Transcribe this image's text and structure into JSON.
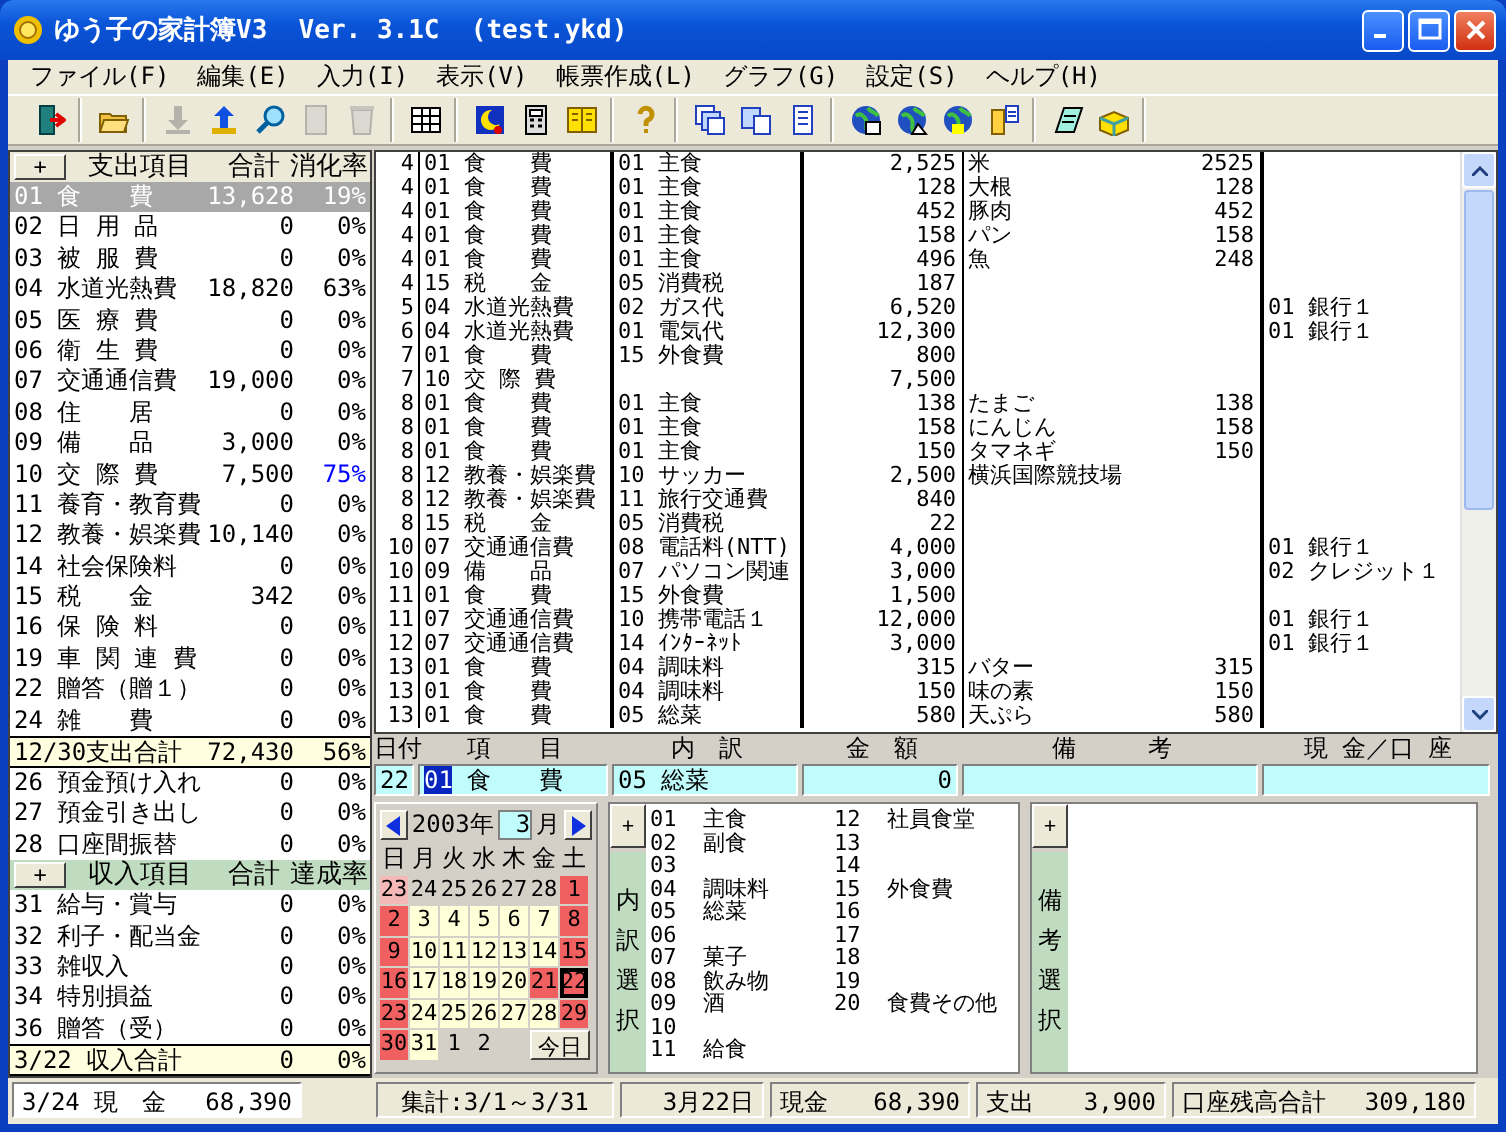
{
  "window": {
    "title": "ゆう子の家計簿V3  Ver. 3.1C  (test.ykd)"
  },
  "menu": [
    "ファイル(F)",
    "編集(E)",
    "入力(I)",
    "表示(V)",
    "帳票作成(L)",
    "グラフ(G)",
    "設定(S)",
    "ヘルプ(H)"
  ],
  "toolbar": [
    [
      {
        "disabled": false
      }
    ],
    [
      {
        "disabled": false
      }
    ],
    [
      {
        "disabled": true
      },
      {
        "disabled": false
      },
      {
        "disabled": false
      },
      {
        "disabled": true
      },
      {
        "disabled": true
      }
    ],
    [
      {
        "disabled": false
      }
    ],
    [
      {
        "disabled": false
      },
      {
        "disabled": false
      },
      {
        "disabled": false
      }
    ],
    [
      {
        "disabled": false
      }
    ],
    [
      {
        "disabled": false
      },
      {
        "disabled": false
      },
      {
        "disabled": false
      }
    ],
    [
      {
        "disabled": false
      },
      {
        "disabled": false
      },
      {
        "disabled": false
      },
      {
        "disabled": false
      }
    ],
    [
      {
        "disabled": false
      },
      {
        "disabled": false
      }
    ]
  ],
  "expense": {
    "button": "+",
    "columns": [
      "支出項目",
      "合計",
      "消化率"
    ],
    "items": [
      {
        "code": "01",
        "name": "食　　費",
        "total": "13,628",
        "rate": "19%",
        "selected": true,
        "alert": false
      },
      {
        "code": "02",
        "name": "日 用 品",
        "total": "0",
        "rate": "0%",
        "selected": false,
        "alert": false
      },
      {
        "code": "03",
        "name": "被 服 費",
        "total": "0",
        "rate": "0%",
        "selected": false,
        "alert": false
      },
      {
        "code": "04",
        "name": "水道光熱費",
        "total": "18,820",
        "rate": "63%",
        "selected": false,
        "alert": false
      },
      {
        "code": "05",
        "name": "医 療 費",
        "total": "0",
        "rate": "0%",
        "selected": false,
        "alert": false
      },
      {
        "code": "06",
        "name": "衛 生 費",
        "total": "0",
        "rate": "0%",
        "selected": false,
        "alert": false
      },
      {
        "code": "07",
        "name": "交通通信費",
        "total": "19,000",
        "rate": "0%",
        "selected": false,
        "alert": false
      },
      {
        "code": "08",
        "name": "住　　居",
        "total": "0",
        "rate": "0%",
        "selected": false,
        "alert": false
      },
      {
        "code": "09",
        "name": "備　　品",
        "total": "3,000",
        "rate": "0%",
        "selected": false,
        "alert": false
      },
      {
        "code": "10",
        "name": "交 際 費",
        "total": "7,500",
        "rate": "75%",
        "selected": false,
        "alert": true
      },
      {
        "code": "11",
        "name": "養育・教育費",
        "total": "0",
        "rate": "0%",
        "selected": false,
        "alert": false
      },
      {
        "code": "12",
        "name": "教養・娯楽費",
        "total": "10,140",
        "rate": "0%",
        "selected": false,
        "alert": false
      },
      {
        "code": "14",
        "name": "社会保険料",
        "total": "0",
        "rate": "0%",
        "selected": false,
        "alert": false
      },
      {
        "code": "15",
        "name": "税　　金",
        "total": "342",
        "rate": "0%",
        "selected": false,
        "alert": false
      },
      {
        "code": "16",
        "name": "保 険 料",
        "total": "0",
        "rate": "0%",
        "selected": false,
        "alert": false
      },
      {
        "code": "19",
        "name": "車 関 連 費",
        "total": "0",
        "rate": "0%",
        "selected": false,
        "alert": false
      },
      {
        "code": "22",
        "name": "贈答（贈１）",
        "total": "0",
        "rate": "0%",
        "selected": false,
        "alert": false
      },
      {
        "code": "24",
        "name": "雑　　費",
        "total": "0",
        "rate": "0%",
        "selected": false,
        "alert": false
      }
    ],
    "total": {
      "label": "12/30支出合計",
      "total": "72,430",
      "rate": "56%"
    }
  },
  "transfers": [
    {
      "code": "26",
      "name": "預金預け入れ",
      "total": "0",
      "rate": "0%"
    },
    {
      "code": "27",
      "name": "預金引き出し",
      "total": "0",
      "rate": "0%"
    },
    {
      "code": "28",
      "name": "口座間振替",
      "total": "0",
      "rate": "0%"
    }
  ],
  "income": {
    "button": "+",
    "columns": [
      "収入項目",
      "合計",
      "達成率"
    ],
    "items": [
      {
        "code": "31",
        "name": "給与・賞与",
        "total": "0",
        "rate": "0%",
        "selected": false,
        "alert": false
      },
      {
        "code": "32",
        "name": "利子・配当金",
        "total": "0",
        "rate": "0%",
        "selected": false,
        "alert": false
      },
      {
        "code": "33",
        "name": "雑収入",
        "total": "0",
        "rate": "0%",
        "selected": false,
        "alert": false
      },
      {
        "code": "34",
        "name": "特別損益",
        "total": "0",
        "rate": "0%",
        "selected": false,
        "alert": false
      },
      {
        "code": "36",
        "name": "贈答（受）",
        "total": "0",
        "rate": "0%",
        "selected": false,
        "alert": false
      }
    ],
    "total": {
      "label": "3/22 収入合計",
      "total": "0",
      "rate": "0%"
    }
  },
  "cash": {
    "label": "3/24 現　金",
    "value": "68,390"
  },
  "entries": [
    {
      "day": "4",
      "category_code": "01",
      "category": "食　　費",
      "sub_code": "01",
      "sub": "主食",
      "amount": "2,525",
      "memo": "米",
      "memo_amount": "2525"
    },
    {
      "day": "4",
      "category_code": "01",
      "category": "食　　費",
      "sub_code": "01",
      "sub": "主食",
      "amount": "128",
      "memo": "大根",
      "memo_amount": "128"
    },
    {
      "day": "4",
      "category_code": "01",
      "category": "食　　費",
      "sub_code": "01",
      "sub": "主食",
      "amount": "452",
      "memo": "豚肉",
      "memo_amount": "452"
    },
    {
      "day": "4",
      "category_code": "01",
      "category": "食　　費",
      "sub_code": "01",
      "sub": "主食",
      "amount": "158",
      "memo": "パン",
      "memo_amount": "158"
    },
    {
      "day": "4",
      "category_code": "01",
      "category": "食　　費",
      "sub_code": "01",
      "sub": "主食",
      "amount": "496",
      "memo": "魚",
      "memo_amount": "248"
    },
    {
      "day": "4",
      "category_code": "15",
      "category": "税　　金",
      "sub_code": "05",
      "sub": "消費税",
      "amount": "187"
    },
    {
      "day": "5",
      "category_code": "04",
      "category": "水道光熱費",
      "sub_code": "02",
      "sub": "ガス代",
      "amount": "6,520",
      "account": "01 銀行１"
    },
    {
      "day": "6",
      "category_code": "04",
      "category": "水道光熱費",
      "sub_code": "01",
      "sub": "電気代",
      "amount": "12,300",
      "account": "01 銀行１"
    },
    {
      "day": "7",
      "category_code": "01",
      "category": "食　　費",
      "sub_code": "15",
      "sub": "外食費",
      "amount": "800"
    },
    {
      "day": "7",
      "category_code": "10",
      "category": "交 際 費",
      "amount": "7,500"
    },
    {
      "day": "8",
      "category_code": "01",
      "category": "食　　費",
      "sub_code": "01",
      "sub": "主食",
      "amount": "138",
      "memo": "たまご",
      "memo_amount": "138"
    },
    {
      "day": "8",
      "category_code": "01",
      "category": "食　　費",
      "sub_code": "01",
      "sub": "主食",
      "amount": "158",
      "memo": "にんじん",
      "memo_amount": "158"
    },
    {
      "day": "8",
      "category_code": "01",
      "category": "食　　費",
      "sub_code": "01",
      "sub": "主食",
      "amount": "150",
      "memo": "タマネギ",
      "memo_amount": "150"
    },
    {
      "day": "8",
      "category_code": "12",
      "category": "教養・娯楽費",
      "sub_code": "10",
      "sub": "サッカー",
      "amount": "2,500",
      "memo": "横浜国際競技場"
    },
    {
      "day": "8",
      "category_code": "12",
      "category": "教養・娯楽費",
      "sub_code": "11",
      "sub": "旅行交通費",
      "amount": "840"
    },
    {
      "day": "8",
      "category_code": "15",
      "category": "税　　金",
      "sub_code": "05",
      "sub": "消費税",
      "amount": "22"
    },
    {
      "day": "10",
      "category_code": "07",
      "category": "交通通信費",
      "sub_code": "08",
      "sub": "電話料(NTT)",
      "amount": "4,000",
      "account": "01 銀行１"
    },
    {
      "day": "10",
      "category_code": "09",
      "category": "備　　品",
      "sub_code": "07",
      "sub": "パソコン関連",
      "amount": "3,000",
      "account": "02 クレジット１"
    },
    {
      "day": "11",
      "category_code": "01",
      "category": "食　　費",
      "sub_code": "15",
      "sub": "外食費",
      "amount": "1,500"
    },
    {
      "day": "11",
      "category_code": "07",
      "category": "交通通信費",
      "sub_code": "10",
      "sub": "携帯電話１",
      "amount": "12,000",
      "account": "01 銀行１"
    },
    {
      "day": "12",
      "category_code": "07",
      "category": "交通通信費",
      "sub_code": "14",
      "sub": "ｲﾝﾀｰﾈｯﾄ",
      "amount": "3,000",
      "account": "01 銀行１"
    },
    {
      "day": "13",
      "category_code": "01",
      "category": "食　　費",
      "sub_code": "04",
      "sub": "調味料",
      "amount": "315",
      "memo": "バター",
      "memo_amount": "315"
    },
    {
      "day": "13",
      "category_code": "01",
      "category": "食　　費",
      "sub_code": "04",
      "sub": "調味料",
      "amount": "150",
      "memo": "味の素",
      "memo_amount": "150"
    },
    {
      "day": "13",
      "category_code": "01",
      "category": "食　　費",
      "sub_code": "05",
      "sub": "総菜",
      "amount": "580",
      "memo": "天ぷら",
      "memo_amount": "580"
    }
  ],
  "entry_form": {
    "columns": [
      "日付",
      "項　　目",
      "内　訳",
      "金　額",
      "備　　　考",
      "現 金／口 座"
    ],
    "day": "22",
    "category_code": "01",
    "category": "食　　費",
    "sub": "05 総菜",
    "amount": "0"
  },
  "calendar": {
    "year": "2003年",
    "month": "3",
    "month_suffix": "月",
    "weekdays": [
      "日",
      "月",
      "火",
      "水",
      "木",
      "金",
      "土"
    ],
    "days": [
      {
        "day": "23",
        "kind": "other_holiday",
        "selected": false
      },
      {
        "day": "24",
        "kind": "other",
        "selected": false
      },
      {
        "day": "25",
        "kind": "other",
        "selected": false
      },
      {
        "day": "26",
        "kind": "other",
        "selected": false
      },
      {
        "day": "27",
        "kind": "other",
        "selected": false
      },
      {
        "day": "28",
        "kind": "other",
        "selected": false
      },
      {
        "day": "1",
        "kind": "holiday",
        "selected": false
      },
      {
        "day": "2",
        "kind": "holiday",
        "selected": false
      },
      {
        "day": "3",
        "kind": "weekday",
        "selected": false
      },
      {
        "day": "4",
        "kind": "weekday",
        "selected": false
      },
      {
        "day": "5",
        "kind": "weekday",
        "selected": false
      },
      {
        "day": "6",
        "kind": "weekday",
        "selected": false
      },
      {
        "day": "7",
        "kind": "weekday",
        "selected": false
      },
      {
        "day": "8",
        "kind": "holiday",
        "selected": false
      },
      {
        "day": "9",
        "kind": "holiday",
        "selected": false
      },
      {
        "day": "10",
        "kind": "weekday",
        "selected": false
      },
      {
        "day": "11",
        "kind": "weekday",
        "selected": false
      },
      {
        "day": "12",
        "kind": "weekday",
        "selected": false
      },
      {
        "day": "13",
        "kind": "weekday",
        "selected": false
      },
      {
        "day": "14",
        "kind": "weekday",
        "selected": false
      },
      {
        "day": "15",
        "kind": "holiday",
        "selected": false
      },
      {
        "day": "16",
        "kind": "holiday",
        "selected": false
      },
      {
        "day": "17",
        "kind": "weekday",
        "selected": false
      },
      {
        "day": "18",
        "kind": "weekday",
        "selected": false
      },
      {
        "day": "19",
        "kind": "weekday",
        "selected": false
      },
      {
        "day": "20",
        "kind": "weekday",
        "selected": false
      },
      {
        "day": "21",
        "kind": "holiday",
        "selected": false
      },
      {
        "day": "22",
        "kind": "holiday",
        "selected": true
      },
      {
        "day": "23",
        "kind": "holiday",
        "selected": false
      },
      {
        "day": "24",
        "kind": "weekday",
        "selected": false
      },
      {
        "day": "25",
        "kind": "weekday",
        "selected": false
      },
      {
        "day": "26",
        "kind": "weekday",
        "selected": false
      },
      {
        "day": "27",
        "kind": "weekday",
        "selected": false
      },
      {
        "day": "28",
        "kind": "weekday",
        "selected": false
      },
      {
        "day": "29",
        "kind": "holiday",
        "selected": false
      },
      {
        "day": "30",
        "kind": "holiday",
        "selected": false
      },
      {
        "day": "31",
        "kind": "weekday",
        "selected": false
      },
      {
        "day": "1",
        "kind": "other",
        "selected": false
      },
      {
        "day": "2",
        "kind": "other",
        "selected": false
      }
    ],
    "today_button": "今日"
  },
  "sub_picker": {
    "button": "+",
    "label": "内訳選択",
    "items": [
      {
        "code": "01",
        "name": "主食"
      },
      {
        "code": "02",
        "name": "副食"
      },
      {
        "code": "03"
      },
      {
        "code": "04",
        "name": "調味料"
      },
      {
        "code": "05",
        "name": "総菜"
      },
      {
        "code": "06"
      },
      {
        "code": "07",
        "name": "菓子"
      },
      {
        "code": "08",
        "name": "飲み物"
      },
      {
        "code": "09",
        "name": "酒"
      },
      {
        "code": "10"
      },
      {
        "code": "11",
        "name": "給食"
      },
      {
        "code": "12",
        "name": "社員食堂"
      },
      {
        "code": "13"
      },
      {
        "code": "14"
      },
      {
        "code": "15",
        "name": "外食費"
      },
      {
        "code": "16"
      },
      {
        "code": "17"
      },
      {
        "code": "18"
      },
      {
        "code": "19"
      },
      {
        "code": "20",
        "name": "食費その他"
      }
    ]
  },
  "memo_picker": {
    "button": "+",
    "label": "備考選択"
  },
  "status_bar": {
    "period": "集計:3/1～3/31",
    "date": "3月22日",
    "cash_label": "現金",
    "cash": "68,390",
    "expense_label": "支出",
    "expense": "3,900",
    "balance_label": "口座残高合計",
    "balance": "309,180"
  }
}
